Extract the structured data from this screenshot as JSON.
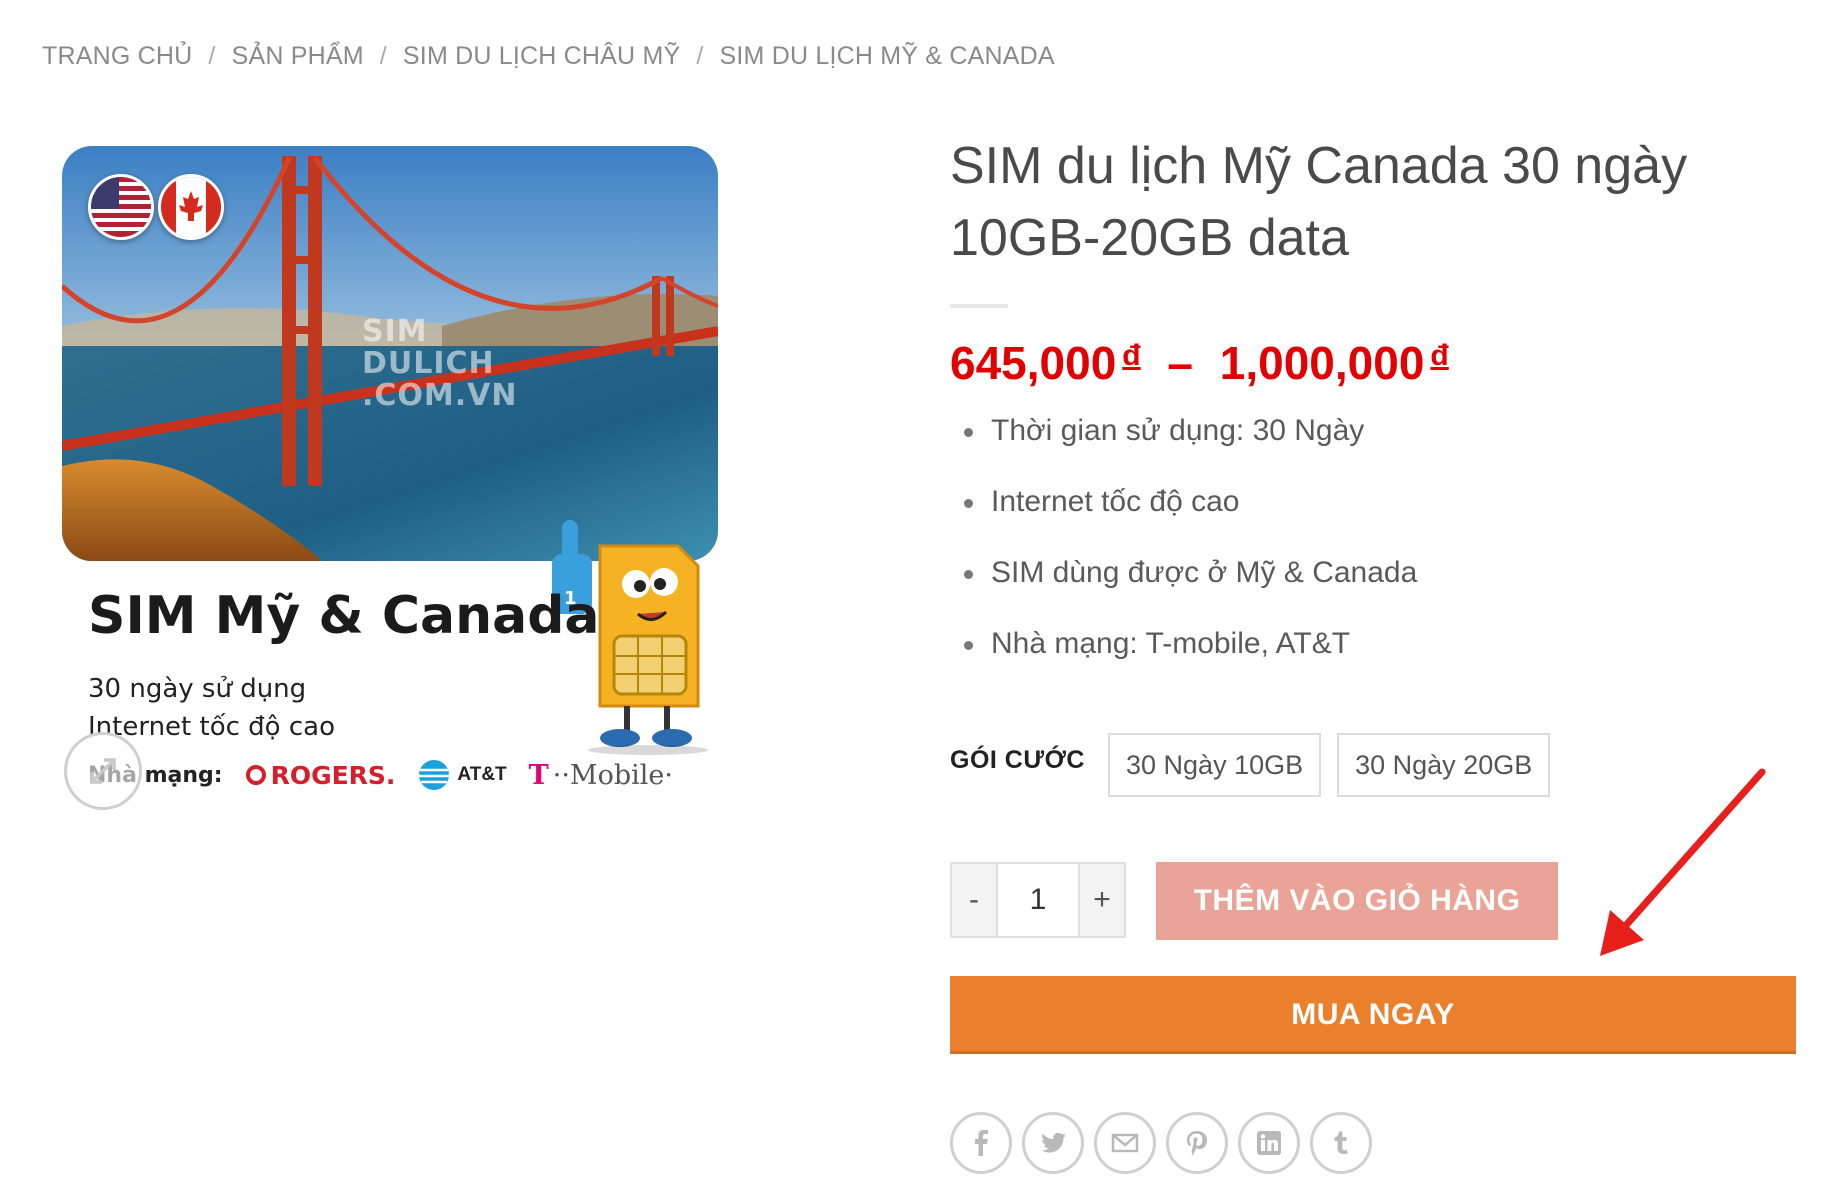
{
  "breadcrumb": {
    "items": [
      "TRANG CHỦ",
      "SẢN PHẨM",
      "SIM DU LỊCH CHÂU MỸ",
      "SIM DU LỊCH MỸ & CANADA"
    ],
    "separator": "/"
  },
  "gallery": {
    "card_title": "SIM Mỹ & Canada",
    "line1": "30 ngày sử dụng",
    "line2": "Internet tốc độ cao",
    "carrier_label": "Nhà mạng:",
    "carrier_rogers": "ROGERS.",
    "carrier_att": "AT&T",
    "carrier_tmobile_t": "T",
    "carrier_tmobile": "··Mobile·",
    "watermark": [
      "SIM",
      "DULICH",
      ".COM.VN"
    ]
  },
  "product": {
    "title": "SIM du lịch Mỹ Canada 30 ngày 10GB-20GB data",
    "price_min": "645,000",
    "price_max": "1,000,000",
    "currency": "đ",
    "price_sep": "–",
    "features": [
      "Thời gian sử dụng: 30 Ngày",
      "Internet tốc độ cao",
      "SIM dùng được ở Mỹ & Canada",
      "Nhà mạng: T-mobile, AT&T"
    ],
    "variation_label": "GÓI CƯỚC",
    "variations": [
      "30 Ngày 10GB",
      "30 Ngày 20GB"
    ],
    "quantity": "1",
    "qty_minus": "-",
    "qty_plus": "+",
    "add_to_cart": "THÊM VÀO GIỎ HÀNG",
    "buy_now": "MUA NGAY"
  },
  "share": [
    "facebook-icon",
    "twitter-icon",
    "email-icon",
    "pinterest-icon",
    "linkedin-icon",
    "tumblr-icon"
  ],
  "colors": {
    "price": "#e30000",
    "add_to_cart": "#e9a497",
    "buy_now": "#ea7f2c",
    "annotation_arrow": "#e8201c"
  }
}
